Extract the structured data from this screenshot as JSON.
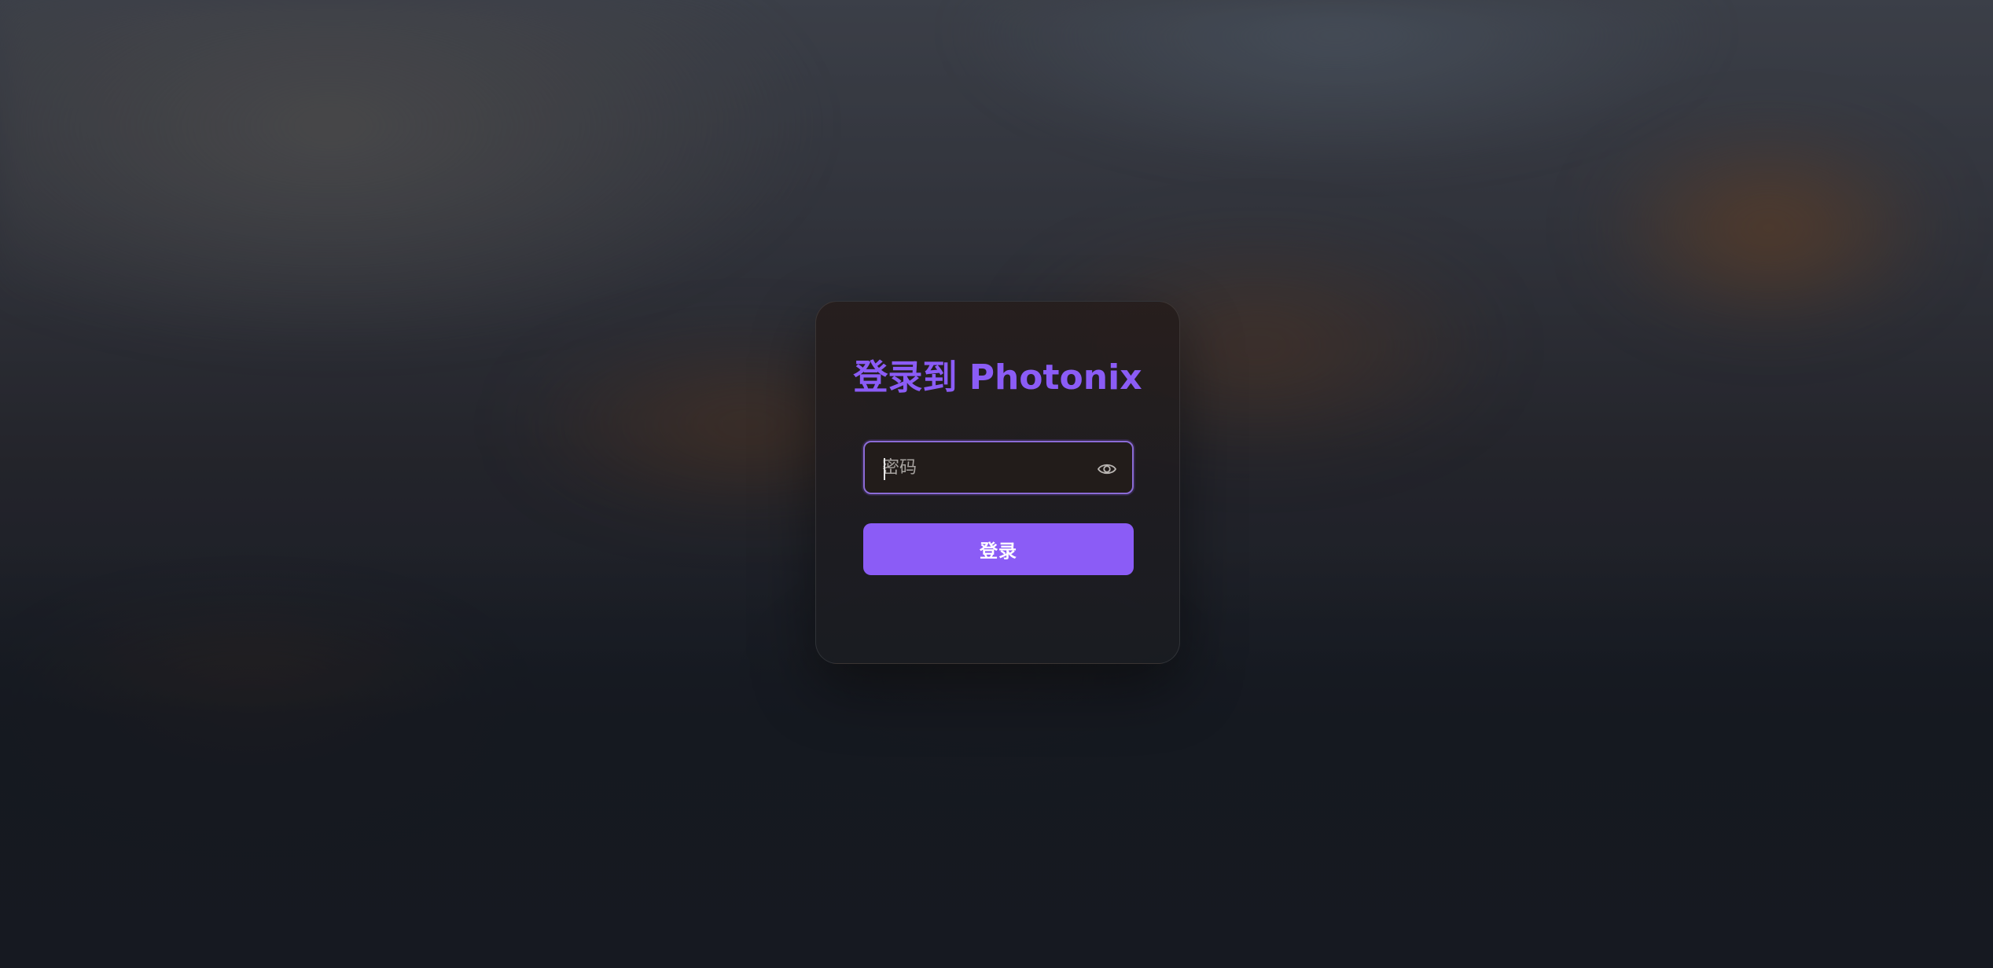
{
  "login": {
    "title": "登录到 Photonix",
    "password_placeholder": "密码",
    "password_value": "",
    "submit_label": "登录",
    "toggle_visibility_icon": "eye-icon"
  },
  "colors": {
    "accent": "#8b5cf6",
    "card_background": "#221c1a",
    "button_text": "#ffffff"
  }
}
